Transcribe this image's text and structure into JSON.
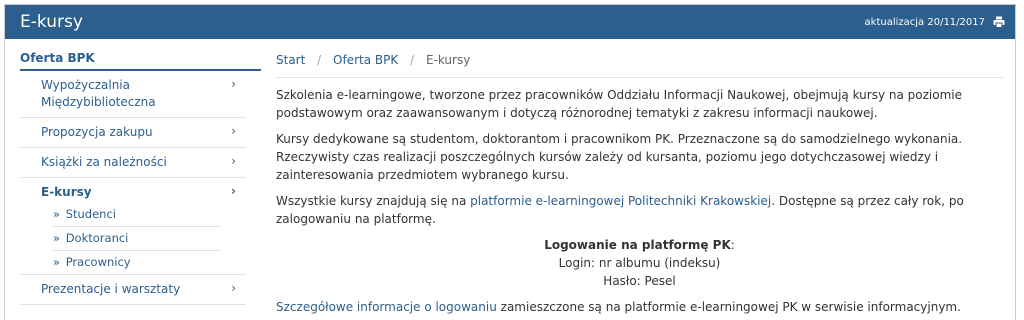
{
  "header": {
    "title": "E-kursy",
    "updated": "aktualizacja 20/11/2017",
    "print_icon": "print-icon"
  },
  "sidebar": {
    "heading": "Oferta BPK",
    "items": [
      {
        "label": "Wypożyczalnia Międzybiblioteczna"
      },
      {
        "label": "Propozycja zakupu"
      },
      {
        "label": "Książki za należności"
      },
      {
        "label": "E-kursy"
      },
      {
        "label": "Prezentacje i warsztaty"
      }
    ],
    "subitems": [
      {
        "label": "Studenci"
      },
      {
        "label": "Doktoranci"
      },
      {
        "label": "Pracownicy"
      }
    ],
    "chevron": "›",
    "bullet": "»"
  },
  "breadcrumb": {
    "items": [
      "Start",
      "Oferta BPK",
      "E-kursy"
    ],
    "separator": "/"
  },
  "content": {
    "p1": "Szkolenia e-learningowe, tworzone przez pracowników Oddziału Informacji Naukowej, obejmują kursy na poziomie podstawowym oraz zaawansowanym i dotyczą różnorodnej tematyki z zakresu informacji naukowej.",
    "p2": "Kursy dedykowane są studentom, doktorantom i pracownikom PK. Przeznaczone są do samodzielnego wykonania. Rzeczywisty czas realizacji poszczególnych kursów zależy od kursanta,  poziomu jego dotychczasowej wiedzy i zainteresowania przedmiotem wybranego kursu.",
    "p3_before": "Wszystkie kursy znajdują się na ",
    "p3_link": "platformie e-learningowej Politechniki Krakowskiej",
    "p3_after": ". Dostępne są przez cały rok, po zalogowaniu na platformę.",
    "login_title": "Logowanie na platformę PK",
    "login_colon": ":",
    "login_line": "Login: nr albumu (indeksu)",
    "password_line": "Hasło: Pesel",
    "p4_link": "Szczegółowe informacje o logowaniu",
    "p4_after": " zamieszczone są na platformie e-learningowej PK w serwisie informacyjnym."
  },
  "colors": {
    "brand": "#2c5f8d",
    "text": "#333333"
  }
}
